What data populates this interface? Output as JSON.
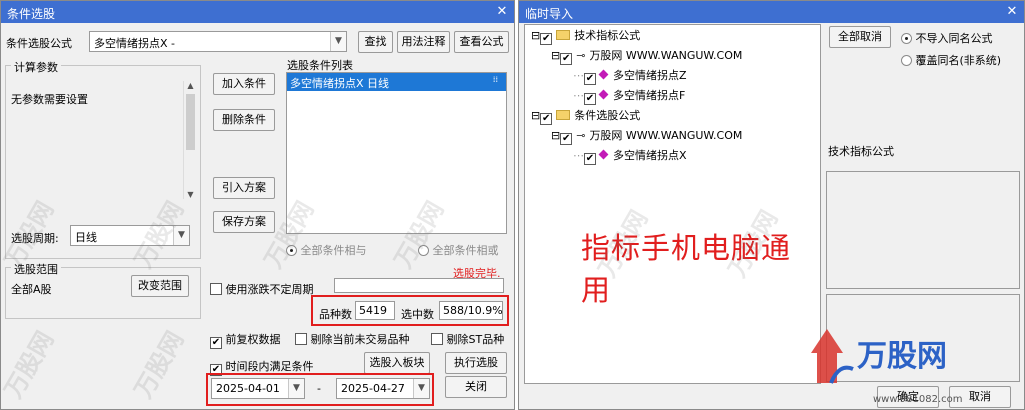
{
  "left_window": {
    "title": "条件选股",
    "formula_label": "条件选股公式",
    "formula_value": "多空情绪拐点X  -",
    "btn_find": "查找",
    "btn_usage": "用法注释",
    "btn_view": "查看公式",
    "calc_params_label": "计算参数",
    "no_params_text": "无参数需要设置",
    "period_label": "选股周期:",
    "period_value": "日线",
    "list_label": "选股条件列表",
    "list_items": [
      "多空情绪拐点X  日线"
    ],
    "btn_add": "加入条件",
    "btn_delete": "删除条件",
    "btn_import": "引入方案",
    "btn_save": "保存方案",
    "radio_and": "全部条件相与",
    "radio_or": "全部条件相或",
    "status": "选股完毕.",
    "range_label": "选股范围",
    "range_value": "全部A股",
    "btn_change_range": "改变范围",
    "cb_irregular": "使用涨跌不定周期",
    "count_label": "品种数",
    "count_value": "5419",
    "selected_label": "选中数",
    "selected_value": "588/10.9%",
    "cb_forward": "前复权数据",
    "cb_untraded": "剔除当前未交易品种",
    "cb_st": "剔除ST品种",
    "cb_period": "时间段内满足条件",
    "btn_to_block": "选股入板块",
    "btn_execute": "执行选股",
    "date_from": "2025-04-01",
    "date_sep": "-",
    "date_to": "2025-04-27",
    "btn_close": "关闭"
  },
  "right_window": {
    "title": "临时导入",
    "tree": [
      {
        "label": "技术指标公式",
        "level": 0,
        "icon": "folder-icon"
      },
      {
        "label": "万股网 WWW.WANGUW.COM",
        "level": 1,
        "icon": "key-icon"
      },
      {
        "label": "多空情绪拐点Z",
        "level": 2,
        "icon": "formula-icon"
      },
      {
        "label": "多空情绪拐点F",
        "level": 2,
        "icon": "formula-icon"
      },
      {
        "label": "条件选股公式",
        "level": 0,
        "icon": "folder-icon"
      },
      {
        "label": "万股网 WWW.WANGUW.COM",
        "level": 1,
        "icon": "key-icon"
      },
      {
        "label": "多空情绪拐点X",
        "level": 2,
        "icon": "formula-icon"
      }
    ],
    "overlay_text": "指标手机电脑通用",
    "btn_cancel_all": "全部取消",
    "radio_no_import": "不导入同名公式",
    "radio_overwrite": "覆盖同名(非系统)",
    "info_label": "技术指标公式",
    "btn_ok": "确定",
    "btn_cancel": "取消"
  },
  "watermark": {
    "brand": "万股网",
    "small": "万股网",
    "url": "www.981082.com"
  },
  "colors": {
    "titlebar": "#3e6fd1",
    "highlight": "#e11e1e",
    "selected_row": "#1e78d6"
  }
}
